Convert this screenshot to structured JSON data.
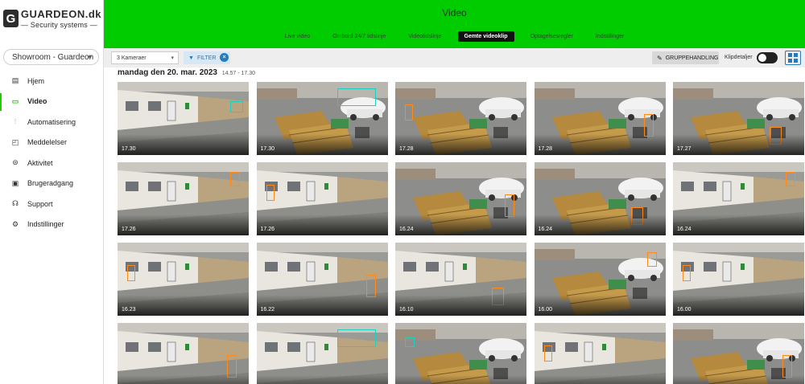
{
  "brand": {
    "name": "GUARDEON.dk",
    "tagline": "Security systems"
  },
  "site_selector": {
    "value": "Showroom - Guardeon"
  },
  "nav": [
    {
      "label": "Hjem",
      "icon": "home-icon",
      "active": false
    },
    {
      "label": "Video",
      "icon": "video-camera-icon",
      "active": true
    },
    {
      "label": "Automatisering",
      "icon": "sliders-icon",
      "active": false
    },
    {
      "label": "Meddelelser",
      "icon": "notification-icon",
      "active": false
    },
    {
      "label": "Aktivitet",
      "icon": "activity-icon",
      "active": false
    },
    {
      "label": "Brugeradgang",
      "icon": "badge-icon",
      "active": false
    },
    {
      "label": "Support",
      "icon": "headset-icon",
      "active": false
    },
    {
      "label": "Indstillinger",
      "icon": "gear-icon",
      "active": false
    }
  ],
  "header": {
    "title": "Video",
    "tabs": [
      {
        "label": "Live video",
        "active": false
      },
      {
        "label": "Ombord 24/7 tidslinje",
        "active": false
      },
      {
        "label": "Videotidslinje",
        "active": false
      },
      {
        "label": "Gemte videoklip",
        "active": true
      },
      {
        "label": "Optagelsesregler",
        "active": false
      },
      {
        "label": "Indstillinger",
        "active": false
      }
    ]
  },
  "toolbar": {
    "camera_select": "3 Kameraer",
    "filter_label": "FILTER",
    "group_action_label": "GRUPPEHANDLING",
    "clip_details_label": "Klipdetaljer",
    "clip_details_on": false
  },
  "date_group": {
    "date": "mandag den 20. mar. 2023",
    "time_range": "14.57 - 17.30"
  },
  "colors": {
    "accent_green": "#00cc00",
    "person_box": "#ff8a1a",
    "vehicle_box": "#1fd0c0",
    "link_blue": "#2a79b8"
  },
  "clips": [
    {
      "time": "17.30",
      "scene": "building",
      "det": "vehicle"
    },
    {
      "time": "17.30",
      "scene": "yard",
      "det": "vehicle"
    },
    {
      "time": "17.28",
      "scene": "yard",
      "det": "person"
    },
    {
      "time": "17.28",
      "scene": "yard",
      "det": "person"
    },
    {
      "time": "17.27",
      "scene": "yard",
      "det": "person"
    },
    {
      "time": "17.26",
      "scene": "building",
      "det": "person"
    },
    {
      "time": "17.26",
      "scene": "building",
      "det": "person"
    },
    {
      "time": "16.24",
      "scene": "yard",
      "det": "person"
    },
    {
      "time": "16.24",
      "scene": "yard",
      "det": "person"
    },
    {
      "time": "16.24",
      "scene": "building",
      "det": "person"
    },
    {
      "time": "16.23",
      "scene": "building",
      "det": "person"
    },
    {
      "time": "16.22",
      "scene": "building",
      "det": "person"
    },
    {
      "time": "16.10",
      "scene": "building",
      "det": "person"
    },
    {
      "time": "16.00",
      "scene": "yard",
      "det": "person"
    },
    {
      "time": "16.00",
      "scene": "building",
      "det": "person"
    },
    {
      "time": "",
      "scene": "building",
      "det": "person"
    },
    {
      "time": "",
      "scene": "building",
      "det": "vehicle"
    },
    {
      "time": "",
      "scene": "yard",
      "det": "vehicle"
    },
    {
      "time": "",
      "scene": "building",
      "det": "person"
    },
    {
      "time": "",
      "scene": "yard",
      "det": "person"
    }
  ]
}
